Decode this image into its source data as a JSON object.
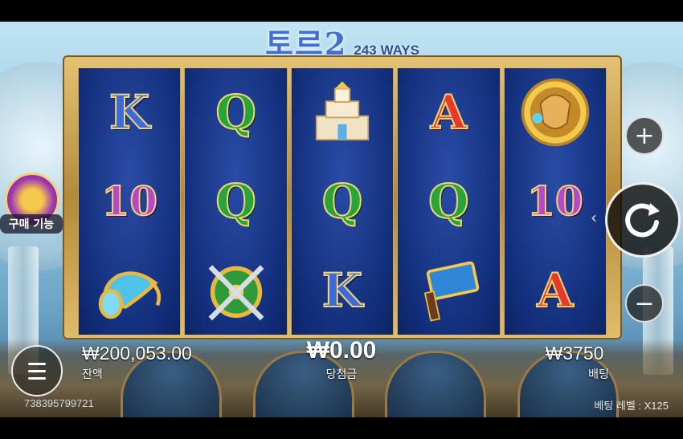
{
  "title": {
    "main": "토르2",
    "ways": "243 WAYS"
  },
  "buy_feature": {
    "label": "구매 기능"
  },
  "reels": [
    [
      "K",
      "10",
      "horn"
    ],
    [
      "Q",
      "Q",
      "shield"
    ],
    [
      "temple",
      "Q",
      "K"
    ],
    [
      "A",
      "Q",
      "hammer"
    ],
    [
      "thor",
      "10",
      "A"
    ]
  ],
  "stats": {
    "balance": {
      "value": "₩200,053.00",
      "label": "잔액"
    },
    "win": {
      "value": "₩0.00",
      "label": "당첨금"
    },
    "bet": {
      "value": "₩3750",
      "label": "배팅"
    }
  },
  "footer": {
    "session_id": "738395799721",
    "bet_level_label": "베팅 레벨",
    "bet_level_value": "X125"
  },
  "controls": {
    "plus": "+",
    "minus": "−",
    "spin_icon": "refresh-icon",
    "menu_icon": "hamburger-icon"
  }
}
